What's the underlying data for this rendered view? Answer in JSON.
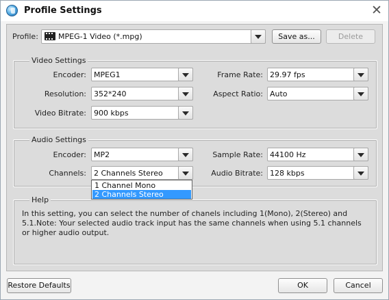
{
  "window": {
    "title": "Profile Settings",
    "app_icon": "globe-icon",
    "close_icon": "close-icon"
  },
  "profile": {
    "label": "Profile:",
    "value": "MPEG-1 Video (*.mpg)",
    "value_icon": "film-icon",
    "save_as": "Save as...",
    "delete": "Delete"
  },
  "video": {
    "title": "Video Settings",
    "encoder_label": "Encoder:",
    "encoder": "MPEG1",
    "resolution_label": "Resolution:",
    "resolution": "352*240",
    "bitrate_label": "Video Bitrate:",
    "bitrate": "900 kbps",
    "framerate_label": "Frame Rate:",
    "framerate": "29.97 fps",
    "aspect_label": "Aspect Ratio:",
    "aspect": "Auto"
  },
  "audio": {
    "title": "Audio Settings",
    "encoder_label": "Encoder:",
    "encoder": "MP2",
    "channels_label": "Channels:",
    "channels": "2 Channels Stereo",
    "samplerate_label": "Sample Rate:",
    "samplerate": "44100 Hz",
    "bitrate_label": "Audio Bitrate:",
    "bitrate": "128 kbps",
    "channels_options": [
      "1 Channel Mono",
      "2 Channels Stereo"
    ]
  },
  "help": {
    "title": "Help",
    "text": "In this setting, you can select the number of chanels including 1(Mono), 2(Stereo) and 5.1.Note: Your selected audio track input has the same channels when using 5.1 channels or higher audio output."
  },
  "footer": {
    "restore": "Restore Defaults",
    "ok": "OK",
    "cancel": "Cancel"
  },
  "colors": {
    "selection": "#3399ff",
    "panel": "#dcdcdc"
  }
}
